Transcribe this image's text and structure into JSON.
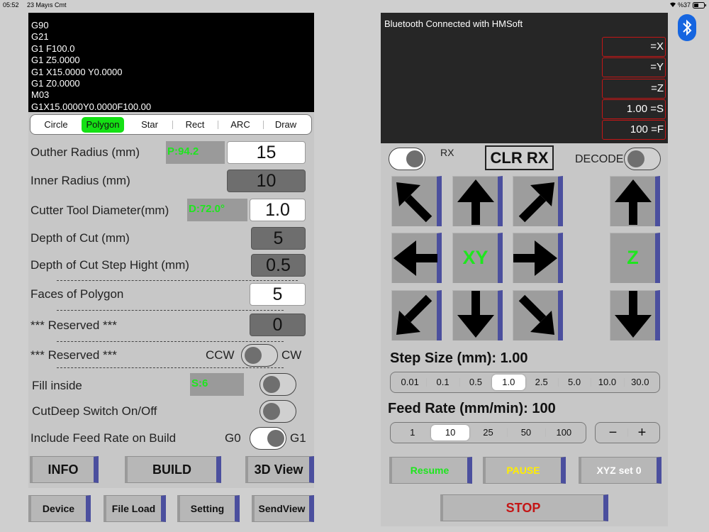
{
  "status": {
    "time": "05:52",
    "date": "23 Mayıs Cmt",
    "battery": "%37"
  },
  "terminal": {
    "lines": [
      "G90",
      "G21",
      "G1 F100.0",
      "G1 Z5.0000",
      "G1 X15.0000 Y0.0000",
      "G1 Z0.0000",
      "M03",
      "G1X15.0000Y0.0000F100.00"
    ]
  },
  "shape_tabs": {
    "items": [
      "Circle",
      "Polygon",
      "Star",
      "Rect",
      "ARC",
      "Draw"
    ],
    "selected": "Polygon"
  },
  "params": {
    "outer_radius": {
      "label": "Outher Radius (mm)",
      "info": "P:94.2",
      "value": "15"
    },
    "inner_radius": {
      "label": "Inner Radius (mm)",
      "value": "10"
    },
    "cutter": {
      "label": "Cutter Tool Diameter(mm)",
      "info": "D:72.0°",
      "value": "1.0"
    },
    "depth": {
      "label": "Depth of Cut (mm)",
      "value": "5"
    },
    "depth_step": {
      "label": "Depth of Cut Step Hight (mm)",
      "value": "0.5"
    },
    "faces": {
      "label": "Faces of Polygon",
      "value": "5"
    },
    "reserved1": {
      "label": "*** Reserved ***",
      "value": "0"
    },
    "reserved2": {
      "label": "*** Reserved ***",
      "ccw": "CCW",
      "cw": "CW"
    },
    "fill": {
      "label": "Fill inside",
      "info": "S:6"
    },
    "cutdeep": {
      "label": "CutDeep Switch On/Off"
    },
    "feedrate_build": {
      "label": "Include Feed Rate on Build",
      "g0": "G0",
      "g1": "G1"
    }
  },
  "actions": {
    "info": "INFO",
    "build": "BUILD",
    "view3d": "3D View"
  },
  "bottom_nav": {
    "device": "Device",
    "file_load": "File Load",
    "setting": "Setting",
    "send_view": "SendView"
  },
  "rx": {
    "message": "Bluetooth Connected with HMSoft",
    "x": "=X",
    "y": "=Y",
    "z": "=Z",
    "s": "1.00 =S",
    "f": "100 =F"
  },
  "controls": {
    "rx_label": "RX",
    "clr_rx": "CLR RX",
    "decode": "DECODE"
  },
  "jog": {
    "xy": "XY",
    "z": "Z"
  },
  "step": {
    "title": "Step Size (mm): 1.00",
    "options": [
      "0.01",
      "0.1",
      "0.5",
      "1.0",
      "2.5",
      "5.0",
      "10.0",
      "30.0"
    ],
    "selected": "1.0"
  },
  "feed": {
    "title": "Feed Rate (mm/min): 100",
    "options": [
      "1",
      "10",
      "25",
      "50",
      "100"
    ],
    "selected": "10",
    "minus": "−",
    "plus": "+"
  },
  "run": {
    "resume": "Resume",
    "pause": "PAUSE",
    "xyz_set0": "XYZ set 0",
    "stop": "STOP"
  },
  "colors": {
    "green": "#1ee61e",
    "yellow": "#ffee00",
    "red": "#c41616",
    "accent": "#4b4f9e",
    "bluetooth": "#1565e0"
  }
}
